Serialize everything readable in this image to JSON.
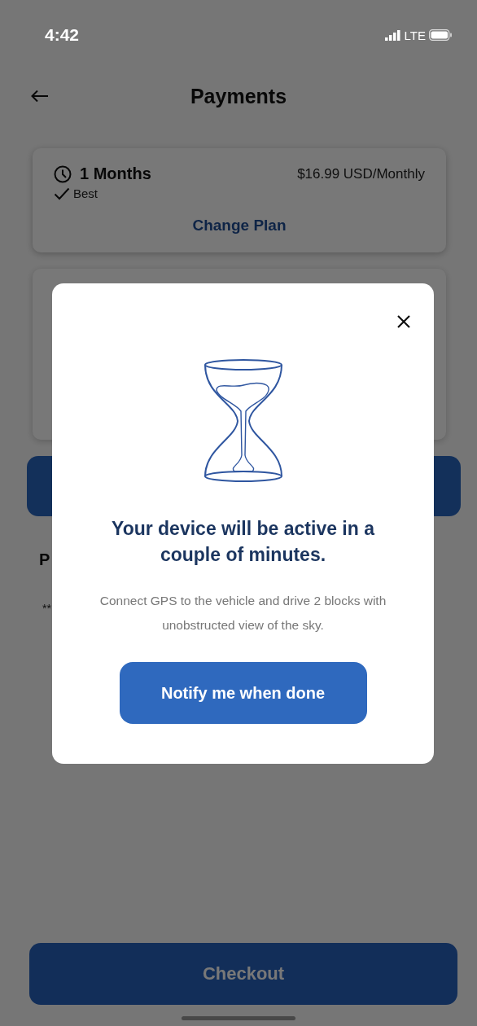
{
  "status_bar": {
    "time": "4:42",
    "network": "LTE"
  },
  "header": {
    "title": "Payments"
  },
  "plan_card": {
    "duration": "1 Months",
    "badge": "Best",
    "price": "$16.99 USD/Monthly",
    "change_link": "Change Plan"
  },
  "payment_section": {
    "title": "P",
    "masked_number": "**"
  },
  "checkout_button": "Checkout",
  "dialog": {
    "title": "Your device will be active in a couple of minutes.",
    "message": "Connect GPS to the vehicle and drive 2 blocks with unobstructed view of the sky.",
    "button": "Notify me when done"
  }
}
